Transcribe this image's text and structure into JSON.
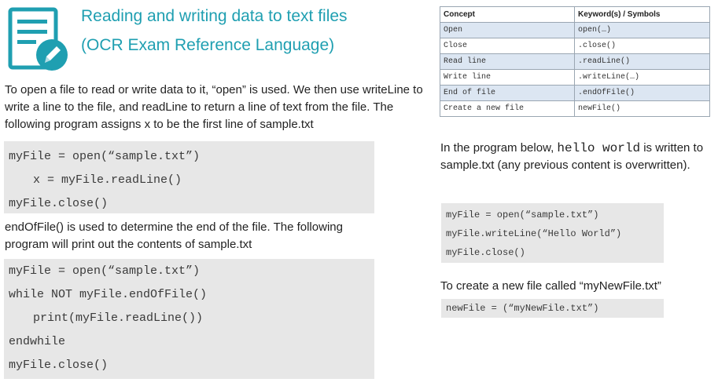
{
  "header": {
    "title_line1": "Reading and writing data to text files",
    "title_line2": "(OCR Exam Reference Language)",
    "accent_color": "#1f9fb1",
    "icon": "document-edit-icon"
  },
  "table": {
    "headers": [
      "Concept",
      "Keyword(s) / Symbols"
    ],
    "rows": [
      [
        "Open",
        "open(…)"
      ],
      [
        "Close",
        ".close()"
      ],
      [
        "Read line",
        ".readLine()"
      ],
      [
        "Write line",
        ".writeLine(…)"
      ],
      [
        "End of file",
        ".endOfFile()"
      ],
      [
        "Create a new file",
        "newFile()"
      ]
    ]
  },
  "intro": {
    "text": "To open a file to read or write data to it, “open” is used.  We then use writeLine to write a line to the file, and readLine to return a line of text from the file.  The following program assigns x to be the first line of sample.txt"
  },
  "code1": {
    "lines": [
      "myFile = open(“sample.txt”)",
      "x = myFile.readLine()",
      "myFile.close()"
    ]
  },
  "eof_text": "endOfFile() is used to determine the end of the file. The following program will print out the contents of sample.txt",
  "code2": {
    "lines": [
      "myFile = open(“sample.txt”)",
      "while NOT myFile.endOfFile()",
      "print(myFile.readLine())",
      "endwhile",
      "myFile.close()"
    ]
  },
  "write_text": {
    "before": "In the program below, ",
    "code": "hello world",
    "after": " is written to sample.txt (any previous content is overwritten)."
  },
  "code3": {
    "lines": [
      "myFile = open(“sample.txt”)",
      "myFile.writeLine(“Hello World”)",
      "myFile.close()"
    ]
  },
  "newfile_text": "To create a new file called “myNewFile.txt”",
  "code4": {
    "lines": [
      "newFile = (“myNewFile.txt”)"
    ]
  }
}
